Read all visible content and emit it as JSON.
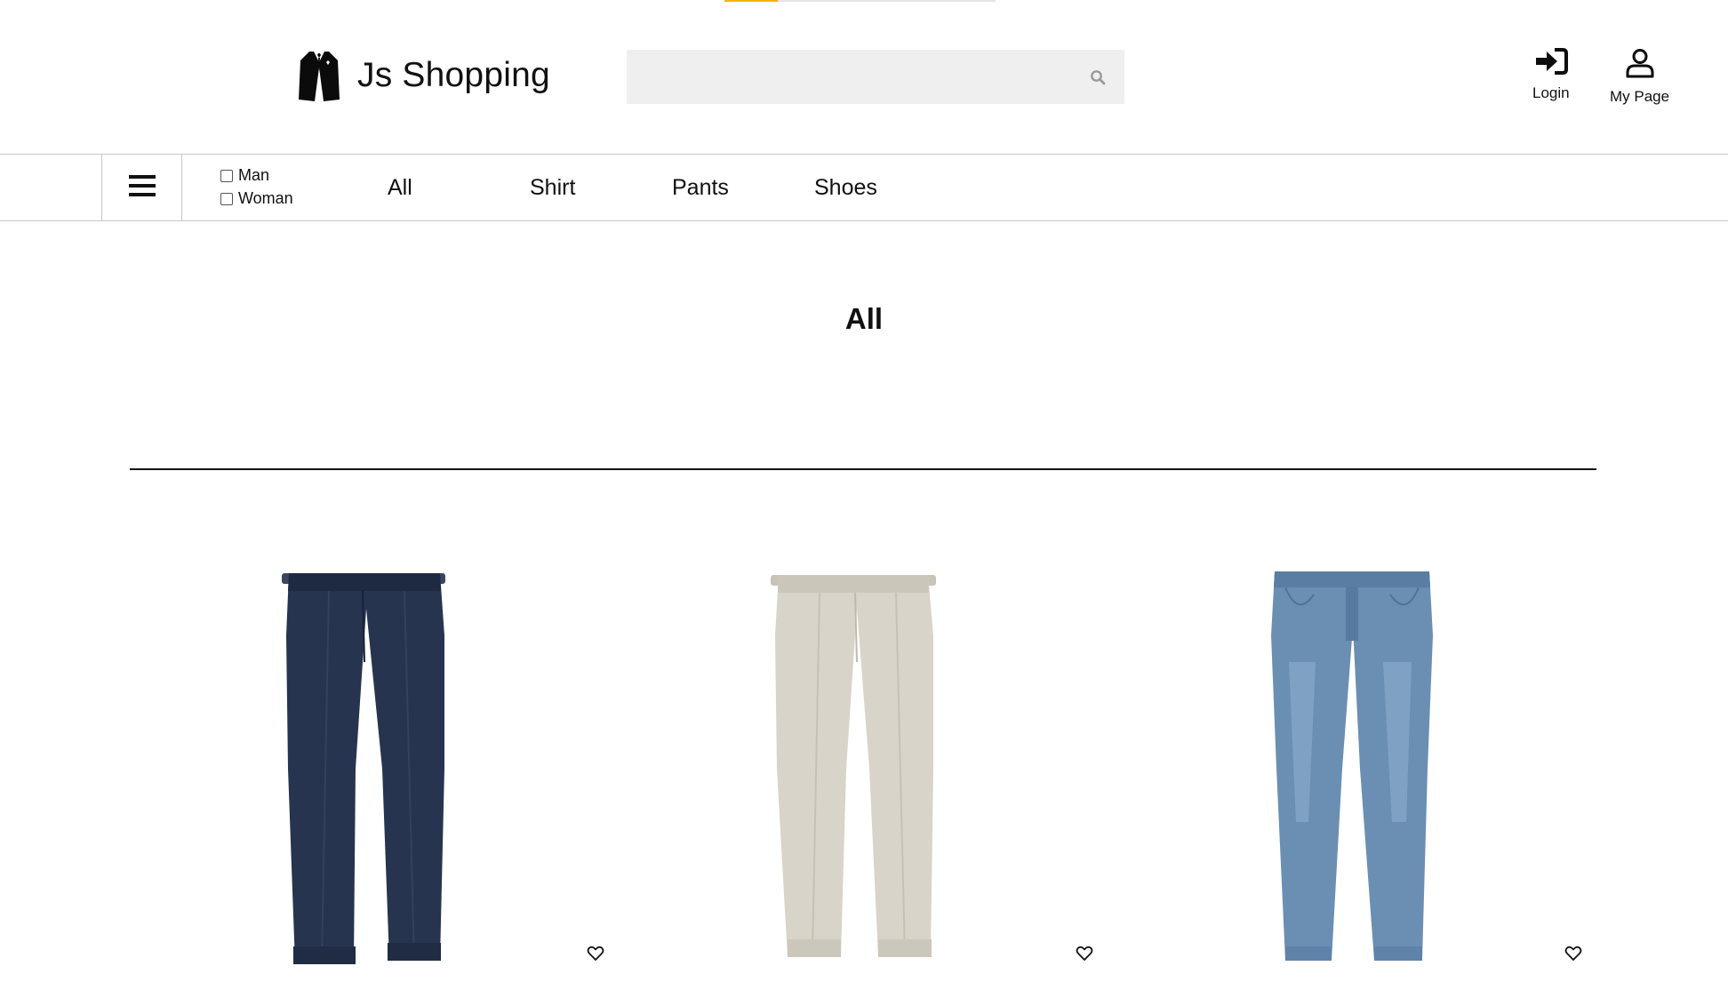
{
  "brand": {
    "name": "Js Shopping"
  },
  "search": {
    "placeholder": "",
    "value": ""
  },
  "header_actions": {
    "login_label": "Login",
    "mypage_label": "My Page"
  },
  "gender_filters": [
    {
      "label": "Man",
      "checked": false
    },
    {
      "label": "Woman",
      "checked": false
    }
  ],
  "categories": [
    "All",
    "Shirt",
    "Pants",
    "Shoes"
  ],
  "main": {
    "section_title": "All"
  },
  "products": [
    {
      "image": "navy-denim-trousers",
      "color": "#27344f"
    },
    {
      "image": "beige-linen-trousers",
      "color": "#d8d4c9"
    },
    {
      "image": "light-blue-jeans",
      "color": "#6b8fb3"
    }
  ],
  "colors": {
    "accent": "#f5b400",
    "search_bg": "#efefef",
    "border": "#c8c8c8"
  },
  "icons": {
    "logo": "suit-jacket-icon",
    "search": "search-icon",
    "login": "login-icon",
    "mypage": "user-icon",
    "menu": "hamburger-menu-icon",
    "wishlist": "heart-icon"
  }
}
